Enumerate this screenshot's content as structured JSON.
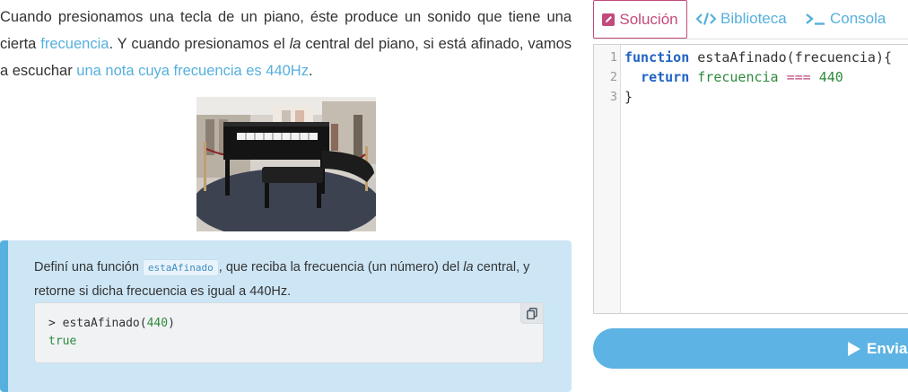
{
  "intro": {
    "part1": "Cuando presionamos una tecla de un piano, éste produce un sonido que tiene una cierta ",
    "link1": "frecuencia",
    "part2": ". Y cuando presionamos el ",
    "la": "la",
    "part3": " central del piano, si está afinado, vamos a escuchar ",
    "link2": "una nota cuya frecuencia es 440Hz",
    "part4": "."
  },
  "task": {
    "part1": "Definí una función ",
    "function_name": "estaAfinado",
    "part2": ", que reciba la frecuencia (un número) del ",
    "la": "la",
    "part3": " central, y retorne si dicha frecuencia es igual a 440Hz.",
    "example": {
      "prompt": "> ",
      "call": "estaAfinado(",
      "arg": "440",
      "close": ")",
      "result": "true"
    }
  },
  "tabs": {
    "solucion": "Solución",
    "biblioteca": "Biblioteca",
    "consola": "Consola"
  },
  "editor": {
    "line_numbers": [
      "1",
      "2",
      "3"
    ],
    "line1_kw": "function",
    "line1_rest": " estaAfinado(frecuencia){",
    "line2_indent": "  ",
    "line2_kw": "return",
    "line2_var": "frecuencia",
    "line2_op": "===",
    "line2_num": "440",
    "line3": "}"
  },
  "send_button": "Enviar",
  "colors": {
    "accent_blue": "#56b0dd",
    "accent_pink": "#c24a7c",
    "task_bg": "#cde6f6",
    "button_bg": "#5db3e3"
  },
  "icons": {
    "solucion": "pencil-square-icon",
    "biblioteca": "code-icon",
    "consola": "terminal-icon",
    "copy": "copy-icon",
    "send": "play-icon"
  }
}
